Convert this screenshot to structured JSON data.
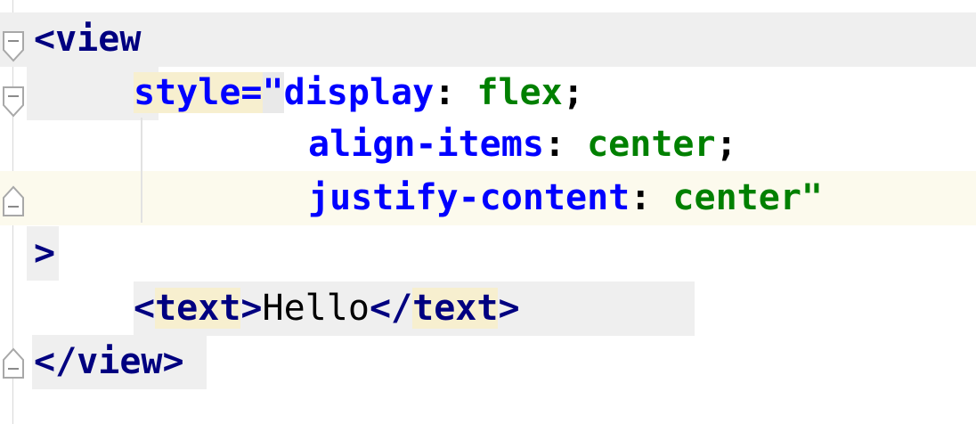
{
  "editor": {
    "lines": [
      {
        "open": "<",
        "tag": "view"
      },
      {
        "attr": "style",
        "eq": "=",
        "quote": "\"",
        "prop": "display",
        "colon": ":",
        "value": " flex",
        "semi": ";"
      },
      {
        "prop": "align-items",
        "colon": ":",
        "value": " center",
        "semi": ";"
      },
      {
        "prop": "justify-content",
        "colon": ":",
        "value": " center",
        "quote": "\""
      },
      {
        "close": ">"
      },
      {
        "open1": "<",
        "tag1": "text",
        "close1": ">",
        "text": "Hello",
        "open2": "</",
        "tag2": "text",
        "close2": ">"
      },
      {
        "open": "</",
        "tag": "view",
        "close": ">"
      }
    ]
  },
  "colors": {
    "tag": "#000080",
    "attribute": "#0000ff",
    "value": "#008000",
    "tag_highlight": "#f7efcf",
    "caret_line": "#fcfaed"
  },
  "icons": [
    "fold-open-icon",
    "fold-close-icon"
  ]
}
